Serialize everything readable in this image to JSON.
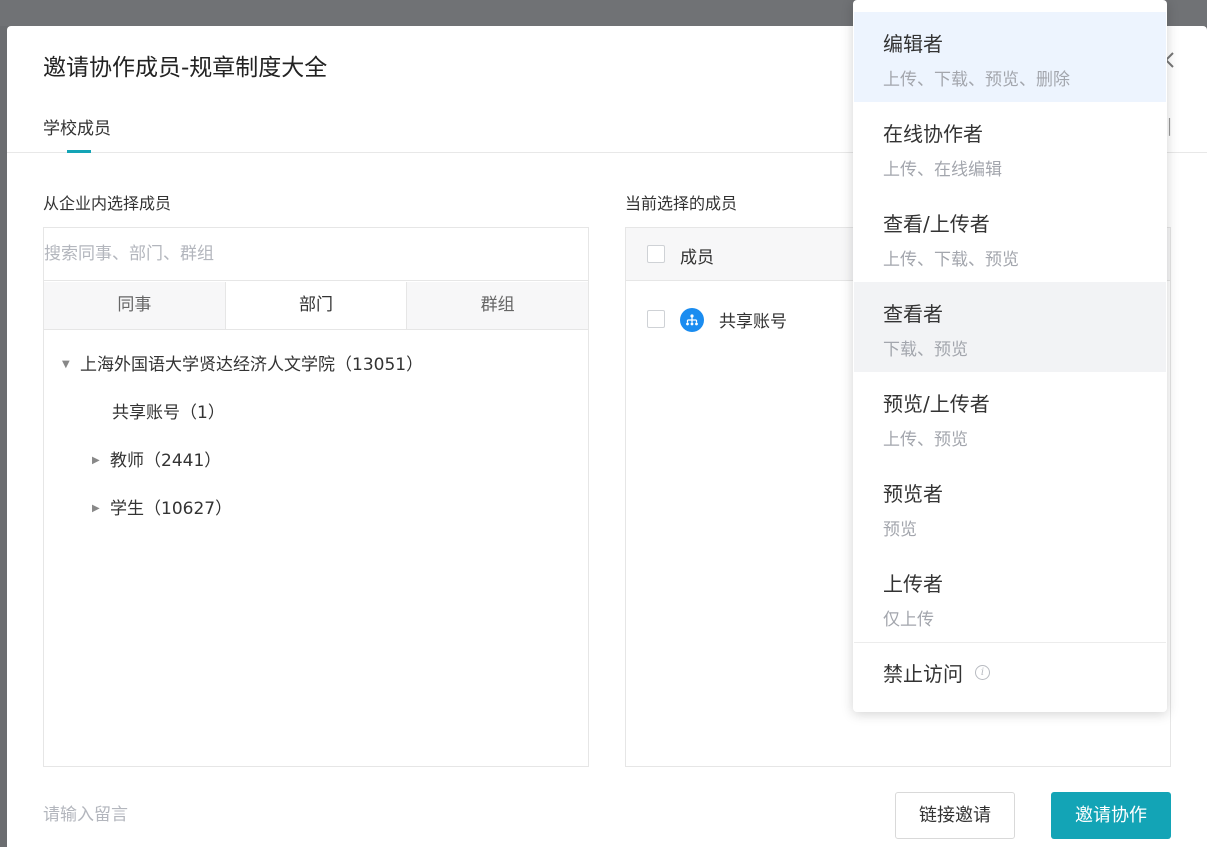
{
  "modal": {
    "title": "邀请协作成员-规章制度大全",
    "tabs": [
      "学校成员"
    ],
    "right_edge_glyph": "│"
  },
  "left": {
    "section_label": "从企业内选择成员",
    "search_placeholder": "搜索同事、部门、群组",
    "seg_tabs": [
      "同事",
      "部门",
      "群组"
    ],
    "active_seg_tab": "部门",
    "tree": [
      {
        "label": "上海外国语大学贤达经济人文学院（13051）",
        "expanded": true
      },
      {
        "label": "共享账号（1）"
      },
      {
        "label": "教师（2441）",
        "expanded": false
      },
      {
        "label": "学生（10627）",
        "expanded": false
      }
    ]
  },
  "right": {
    "section_label": "当前选择的成员",
    "header_label": "成员",
    "members": [
      {
        "name": "共享账号",
        "icon": "org-chart-icon"
      }
    ]
  },
  "footer": {
    "message_placeholder": "请输入留言",
    "link_invite_label": "链接邀请",
    "invite_label": "邀请协作"
  },
  "role_dropdown": {
    "roles": [
      {
        "name": "编辑者",
        "desc": "上传、下载、预览、删除",
        "state": "selected"
      },
      {
        "name": "在线协作者",
        "desc": "上传、在线编辑"
      },
      {
        "name": "查看/上传者",
        "desc": "上传、下载、预览"
      },
      {
        "name": "查看者",
        "desc": "下载、预览",
        "state": "hovered"
      },
      {
        "name": "预览/上传者",
        "desc": "上传、预览"
      },
      {
        "name": "预览者",
        "desc": "预览"
      },
      {
        "name": "上传者",
        "desc": "仅上传"
      }
    ],
    "deny": "禁止访问",
    "info_glyph": "i"
  },
  "colors": {
    "accent": "#13a4b6",
    "selected_bg": "#edf4fe",
    "hover_bg": "#f2f3f5",
    "org_icon": "#1a8cf0"
  }
}
